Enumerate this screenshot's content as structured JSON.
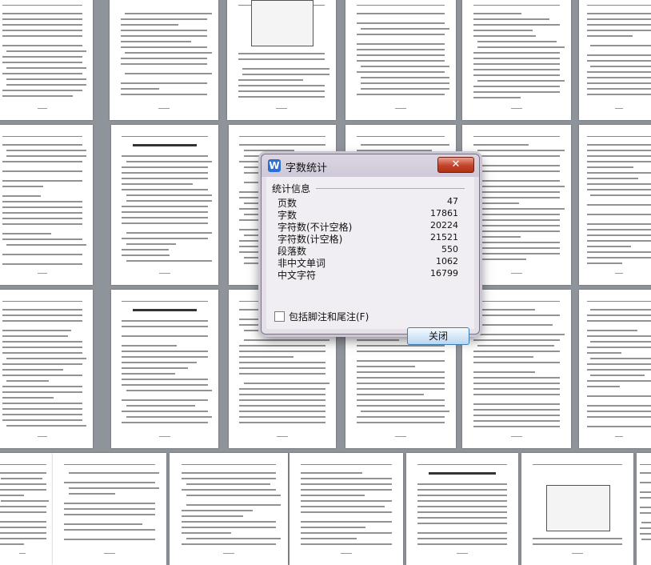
{
  "dialog": {
    "title": "字数统计",
    "app_icon": "W",
    "close_icon_glyph": "✕",
    "group_label": "统计信息",
    "stats": [
      {
        "label": "页数",
        "value": "47"
      },
      {
        "label": "字数",
        "value": "17861"
      },
      {
        "label": "字符数(不计空格)",
        "value": "20224"
      },
      {
        "label": "字符数(计空格)",
        "value": "21521"
      },
      {
        "label": "段落数",
        "value": "550"
      },
      {
        "label": "非中文单词",
        "value": "1062"
      },
      {
        "label": "中文字符",
        "value": "16799"
      }
    ],
    "checkbox_label": "包括脚注和尾注(F)",
    "checkbox_checked": false,
    "close_button_label": "关闭"
  },
  "colors": {
    "workspace_bg": "#8f949b",
    "close_x_red": "#c2432a",
    "button_border_blue": "#3c7fb1",
    "app_icon_blue": "#2a6fd6"
  }
}
